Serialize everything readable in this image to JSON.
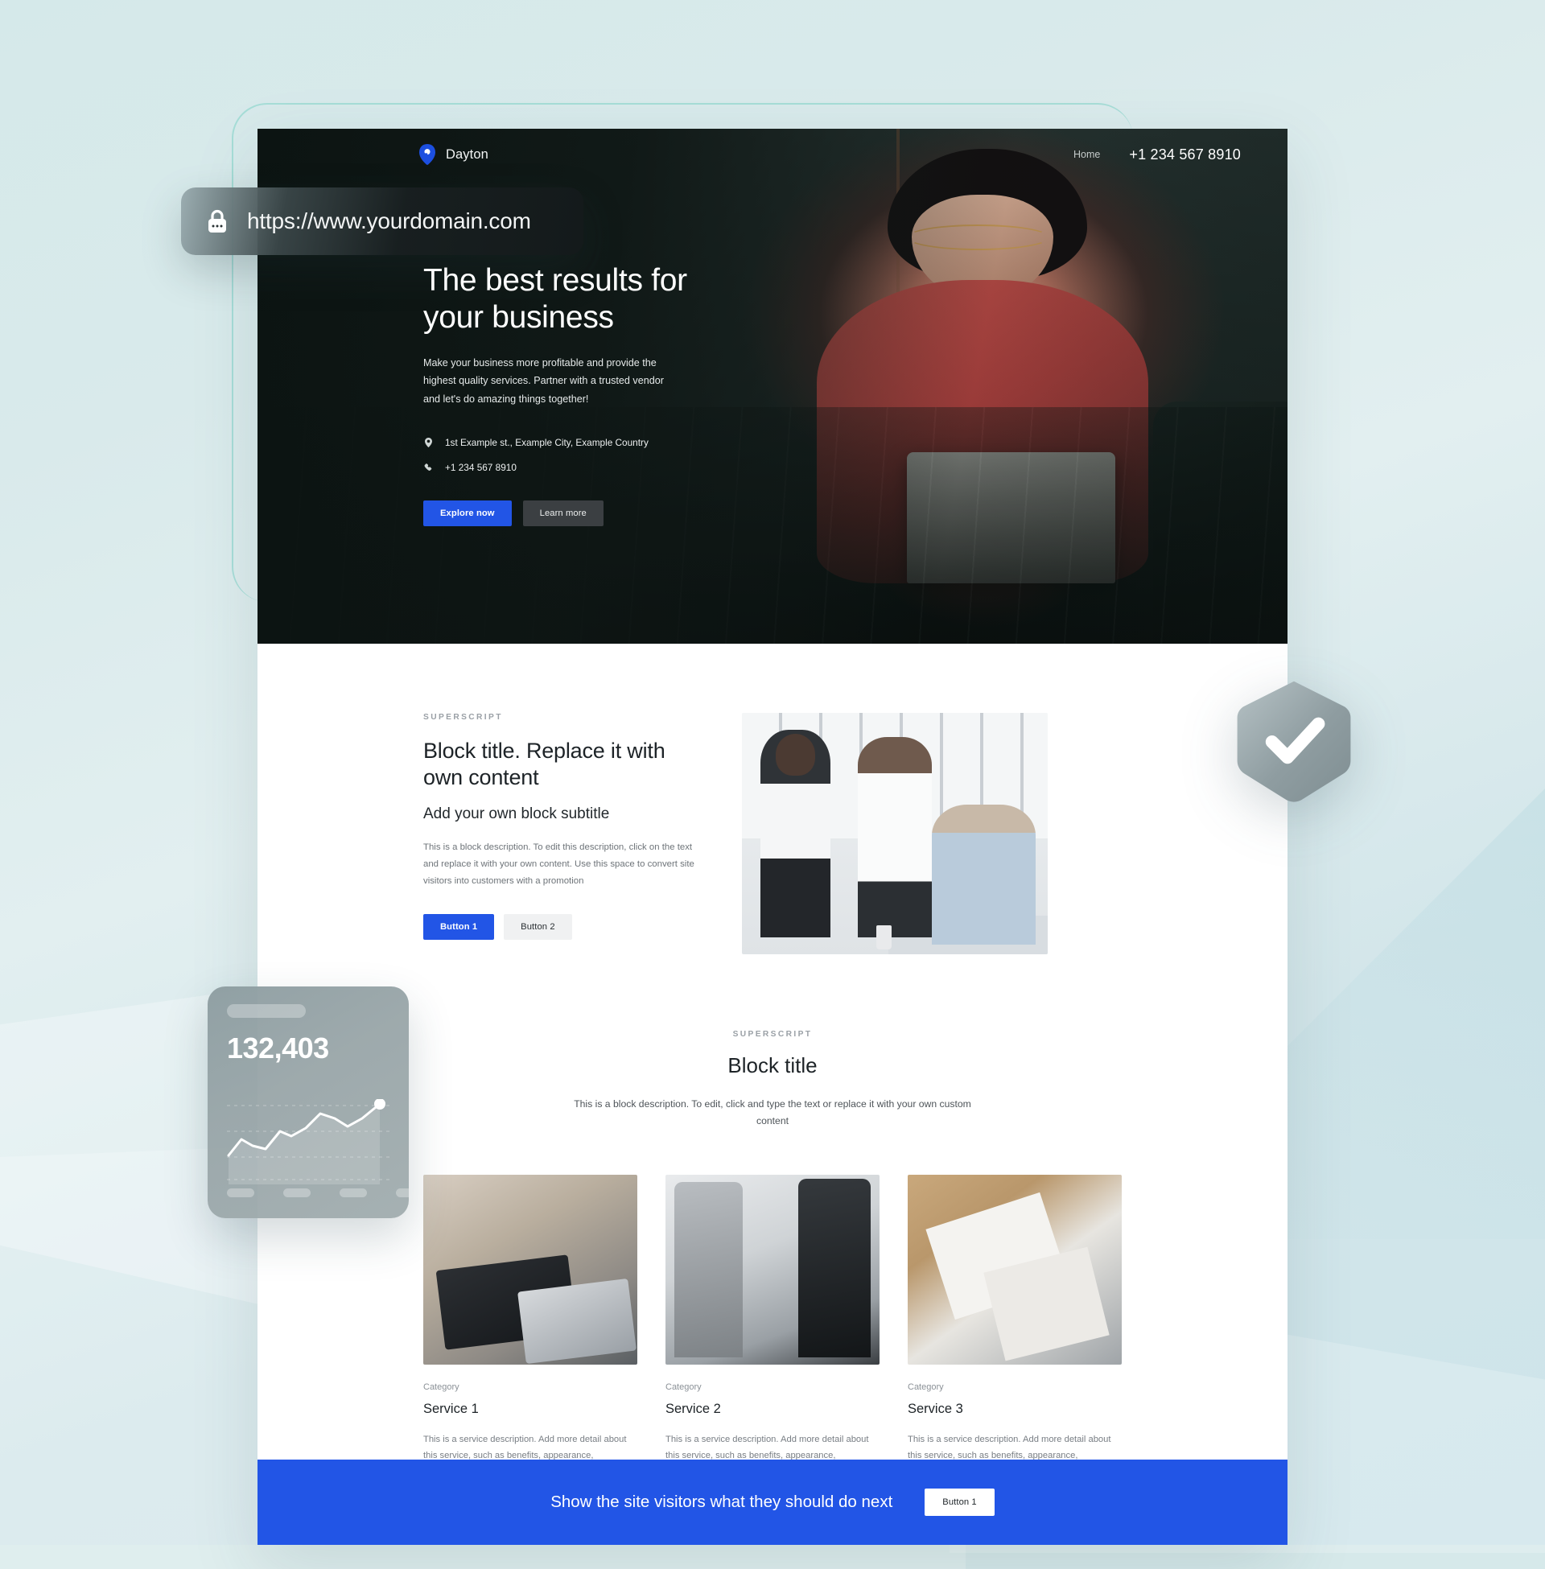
{
  "browser": {
    "url": "https://www.yourdomain.com",
    "lock_icon": "lock-icon"
  },
  "site": {
    "header": {
      "logo_icon": "location-pin-logo-icon",
      "brand": "Dayton",
      "nav_links": [
        "Home"
      ],
      "phone": "+1 234 567 8910"
    },
    "hero": {
      "title_line1": "The best results for",
      "title_line2": "your business",
      "subtitle": "Make your business more profitable and provide the highest quality services. Partner with a trusted vendor and let's do amazing things together!",
      "address_icon": "map-pin-icon",
      "address": "1st Example st., Example City, Example Country",
      "phone_icon": "phone-icon",
      "phone": "+1 234 567 8910",
      "primary_button": "Explore now",
      "secondary_button": "Learn more"
    },
    "block_one": {
      "superscript": "SUPERSCRIPT",
      "title": "Block title. Replace it with own content",
      "subtitle": "Add your own block subtitle",
      "description": "This is a block description. To edit this description, click on the text and replace it with your own content. Use this space to convert site visitors into customers with a promotion",
      "button_1": "Button 1",
      "button_2": "Button 2",
      "image_alt": "three-colleagues-meeting-photo"
    },
    "block_two": {
      "superscript": "SUPERSCRIPT",
      "title": "Block title",
      "description": "This is a block description. To edit, click and type the text or replace it with your own custom content",
      "cards": [
        {
          "category": "Category",
          "title": "Service 1",
          "description": "This is a service description. Add more detail about this service, such as benefits, appearance, components and value",
          "image_alt": "designer-at-desk-with-tablet-photo"
        },
        {
          "category": "Category",
          "title": "Service 2",
          "description": "This is a service description. Add more detail about this service, such as benefits, appearance, components and value",
          "image_alt": "business-handshake-photo"
        },
        {
          "category": "Category",
          "title": "Service 3",
          "description": "This is a service description. Add more detail about this service, such as benefits, appearance, components and value",
          "image_alt": "signing-contract-photo"
        }
      ]
    },
    "cta": {
      "text": "Show the site visitors what they should do next",
      "button": "Button 1"
    }
  },
  "stat_card": {
    "value": "132,403",
    "chart_icon": "line-chart-icon"
  },
  "badge": {
    "icon": "shield-check-icon"
  },
  "colors": {
    "accent_blue": "#2255e6",
    "page_background": "#d6e9ea",
    "hero_overlay": "#0e1614",
    "muted_text": "#787e84"
  }
}
